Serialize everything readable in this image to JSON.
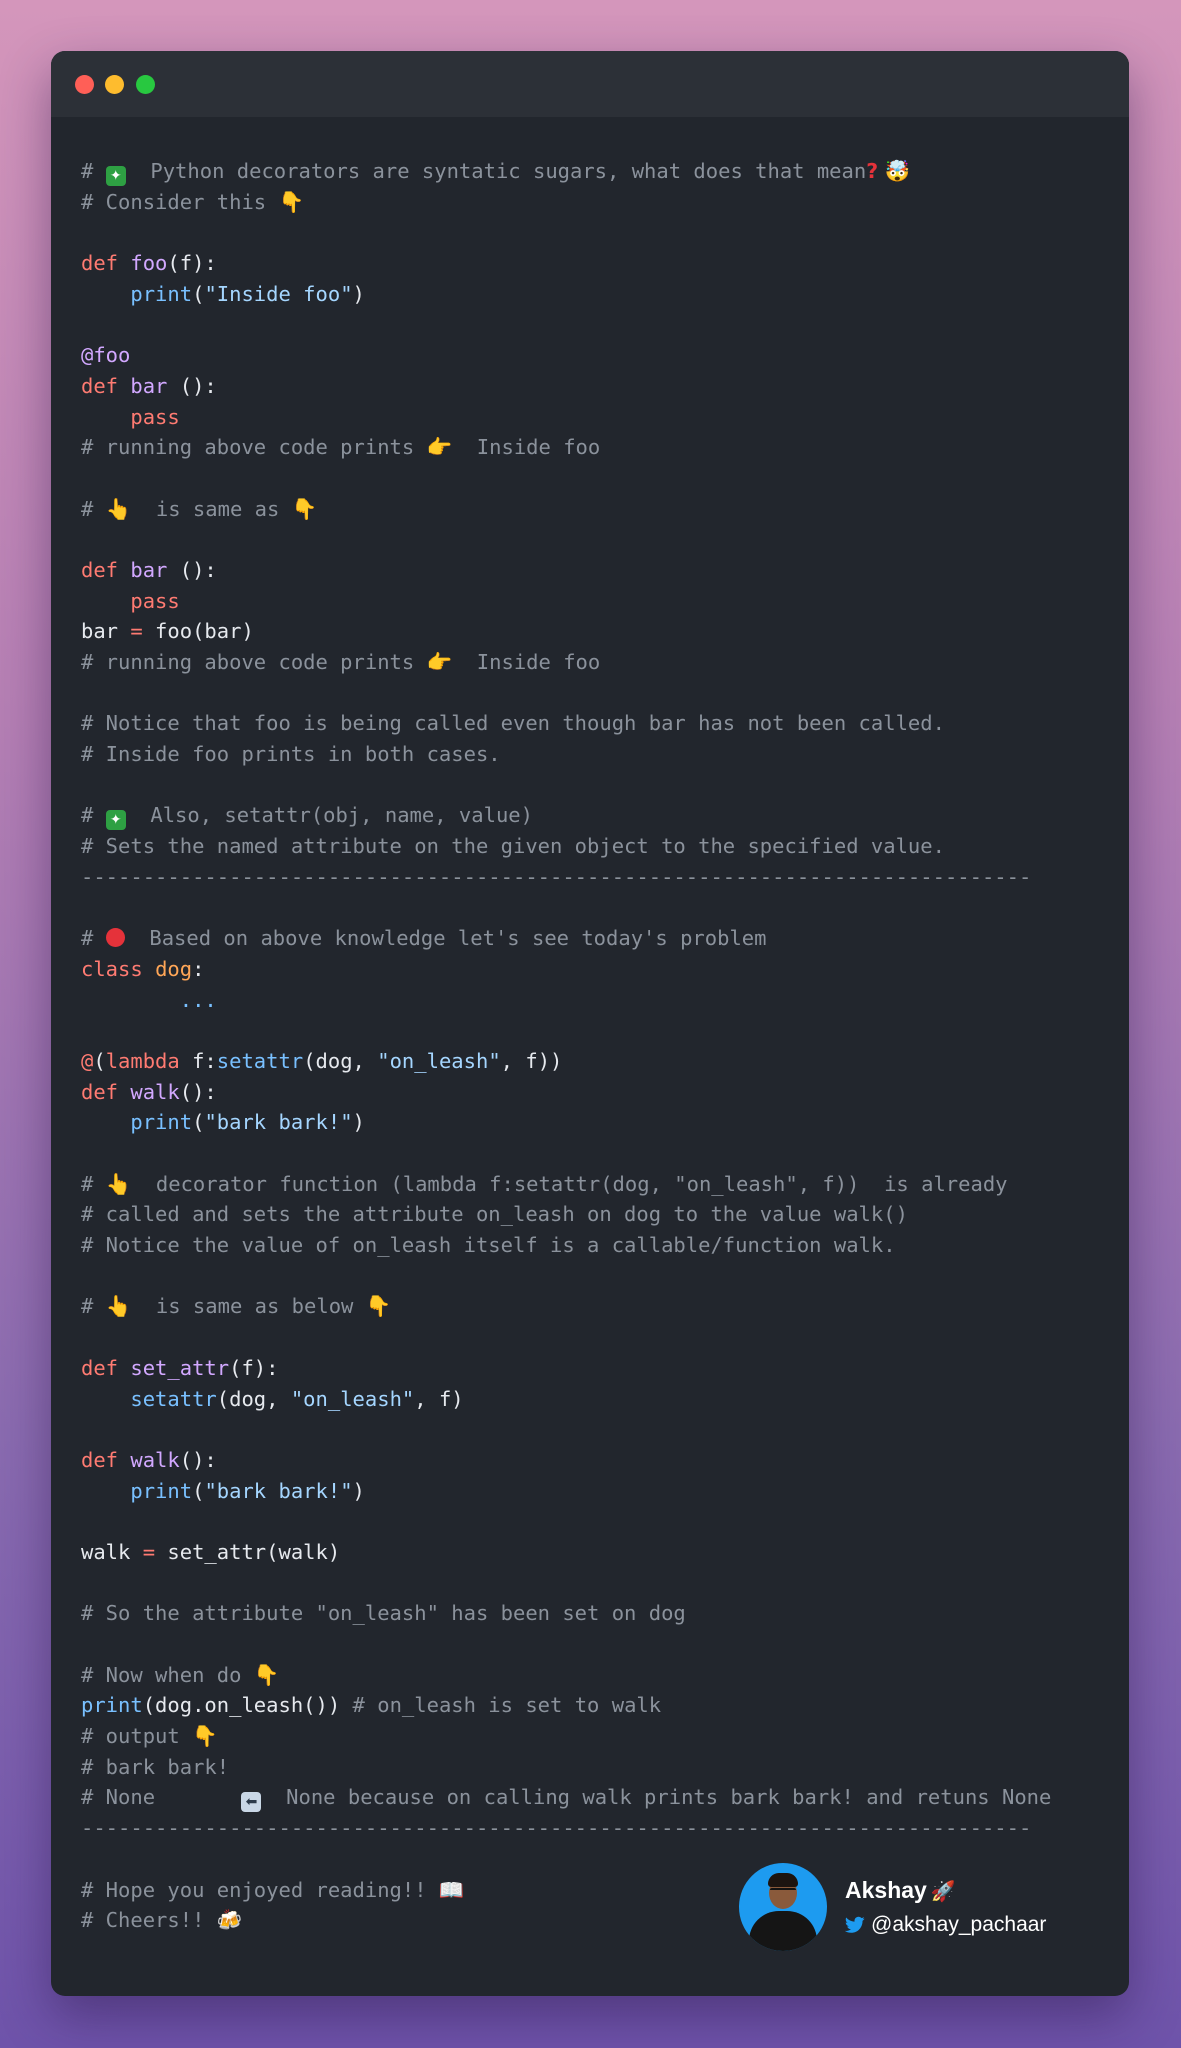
{
  "lines": [
    [
      [
        "c",
        "# "
      ],
      [
        "emo-sq",
        "✦"
      ],
      [
        "c",
        "  Python decorators are syntatic sugars, what does that mean"
      ],
      [
        "emo-q",
        "?"
      ],
      [
        "emo-face",
        " 🤯"
      ]
    ],
    [
      [
        "c",
        "# Consider this "
      ],
      [
        "emo-hand",
        "👇"
      ]
    ],
    [],
    [
      [
        "k",
        "def "
      ],
      [
        "f",
        "foo"
      ],
      [
        "n",
        "(f):"
      ]
    ],
    [
      [
        "n",
        "    "
      ],
      [
        "b",
        "print"
      ],
      [
        "n",
        "("
      ],
      [
        "s",
        "\"Inside foo\""
      ],
      [
        "n",
        ")"
      ]
    ],
    [],
    [
      [
        "dec",
        "@foo"
      ]
    ],
    [
      [
        "k",
        "def "
      ],
      [
        "f",
        "bar"
      ],
      [
        "n",
        " ():"
      ]
    ],
    [
      [
        "n",
        "    "
      ],
      [
        "k",
        "pass"
      ]
    ],
    [
      [
        "c",
        "# running above code prints "
      ],
      [
        "emo-hand",
        "👉"
      ],
      [
        "c",
        "  Inside foo"
      ]
    ],
    [],
    [
      [
        "c",
        "# "
      ],
      [
        "emo-hand",
        "👆"
      ],
      [
        "c",
        "  is same as "
      ],
      [
        "emo-hand",
        "👇"
      ]
    ],
    [],
    [
      [
        "k",
        "def "
      ],
      [
        "f",
        "bar"
      ],
      [
        "n",
        " ():"
      ]
    ],
    [
      [
        "n",
        "    "
      ],
      [
        "k",
        "pass"
      ]
    ],
    [
      [
        "n",
        "bar "
      ],
      [
        "k",
        "="
      ],
      [
        "n",
        " foo(bar)"
      ]
    ],
    [
      [
        "c",
        "# running above code prints "
      ],
      [
        "emo-hand",
        "👉"
      ],
      [
        "c",
        "  Inside foo"
      ]
    ],
    [],
    [
      [
        "c",
        "# Notice that foo is being called even though bar has not been called."
      ]
    ],
    [
      [
        "c",
        "# Inside foo prints in both cases."
      ]
    ],
    [],
    [
      [
        "c",
        "# "
      ],
      [
        "emo-sq",
        "✦"
      ],
      [
        "c",
        "  Also, setattr(obj, name, value)"
      ]
    ],
    [
      [
        "c",
        "# Sets the named attribute on the given object to the specified value."
      ]
    ],
    [
      [
        "c",
        "-----------------------------------------------------------------------------"
      ]
    ],
    [],
    [
      [
        "c",
        "# "
      ],
      [
        "emo-red",
        ""
      ],
      [
        "c",
        "  Based on above knowledge let's see today's problem"
      ]
    ],
    [
      [
        "k",
        "class "
      ],
      [
        "cl",
        "dog"
      ],
      [
        "n",
        ":"
      ]
    ],
    [
      [
        "n",
        "        "
      ],
      [
        "b",
        "..."
      ]
    ],
    [],
    [
      [
        "k",
        "@"
      ],
      [
        "n",
        "("
      ],
      [
        "k",
        "lambda"
      ],
      [
        "n",
        " f:"
      ],
      [
        "b",
        "setattr"
      ],
      [
        "n",
        "(dog, "
      ],
      [
        "s",
        "\"on_leash\""
      ],
      [
        "n",
        ", f))"
      ]
    ],
    [
      [
        "k",
        "def "
      ],
      [
        "f",
        "walk"
      ],
      [
        "n",
        "():"
      ]
    ],
    [
      [
        "n",
        "    "
      ],
      [
        "b",
        "print"
      ],
      [
        "n",
        "("
      ],
      [
        "s",
        "\"bark bark!\""
      ],
      [
        "n",
        ")"
      ]
    ],
    [],
    [
      [
        "c",
        "# "
      ],
      [
        "emo-hand",
        "👆"
      ],
      [
        "c",
        "  decorator function (lambda f:setattr(dog, \"on_leash\", f))  is already"
      ]
    ],
    [
      [
        "c",
        "# called and sets the attribute on_leash on dog to the value walk()"
      ]
    ],
    [
      [
        "c",
        "# Notice the value of on_leash itself is a callable/function walk."
      ]
    ],
    [],
    [
      [
        "c",
        "# "
      ],
      [
        "emo-hand",
        "👆"
      ],
      [
        "c",
        "  is same as below "
      ],
      [
        "emo-hand",
        "👇"
      ]
    ],
    [],
    [
      [
        "k",
        "def "
      ],
      [
        "f",
        "set_attr"
      ],
      [
        "n",
        "(f):"
      ]
    ],
    [
      [
        "n",
        "    "
      ],
      [
        "b",
        "setattr"
      ],
      [
        "n",
        "(dog, "
      ],
      [
        "s",
        "\"on_leash\""
      ],
      [
        "n",
        ", f)"
      ]
    ],
    [],
    [
      [
        "k",
        "def "
      ],
      [
        "f",
        "walk"
      ],
      [
        "n",
        "():"
      ]
    ],
    [
      [
        "n",
        "    "
      ],
      [
        "b",
        "print"
      ],
      [
        "n",
        "("
      ],
      [
        "s",
        "\"bark bark!\""
      ],
      [
        "n",
        ")"
      ]
    ],
    [],
    [
      [
        "n",
        "walk "
      ],
      [
        "k",
        "="
      ],
      [
        "n",
        " set_attr(walk)"
      ]
    ],
    [],
    [
      [
        "c",
        "# So the attribute \"on_leash\" has been set on dog"
      ]
    ],
    [],
    [
      [
        "c",
        "# Now when do "
      ],
      [
        "emo-hand",
        "👇"
      ]
    ],
    [
      [
        "b",
        "print"
      ],
      [
        "n",
        "(dog.on_leash()) "
      ],
      [
        "c",
        "# on_leash is set to walk"
      ]
    ],
    [
      [
        "c",
        "# output "
      ],
      [
        "emo-hand",
        "👇"
      ]
    ],
    [
      [
        "c",
        "# bark bark!"
      ]
    ],
    [
      [
        "c",
        "# None       "
      ],
      [
        "emo-arrow",
        "⬅"
      ],
      [
        "c",
        "  None because on calling walk prints bark bark! and retuns None"
      ]
    ],
    [
      [
        "c",
        "-----------------------------------------------------------------------------"
      ]
    ],
    [],
    [
      [
        "c",
        "# Hope you enjoyed reading!! "
      ],
      [
        "emo-book",
        "📖"
      ]
    ],
    [
      [
        "c",
        "# Cheers!! "
      ],
      [
        "emo-beer",
        "🍻"
      ]
    ]
  ],
  "author": {
    "name": "Akshay",
    "name_emoji": "🚀",
    "handle": "@akshay_pachaar",
    "handle_icon": "twitter-icon",
    "avatar_color": "#1d9bf0"
  },
  "window": {
    "buttons": [
      "close",
      "minimize",
      "maximize"
    ],
    "colors": {
      "close": "#ff5f57",
      "minimize": "#febc2e",
      "maximize": "#28c840",
      "background": "#22262d"
    }
  }
}
